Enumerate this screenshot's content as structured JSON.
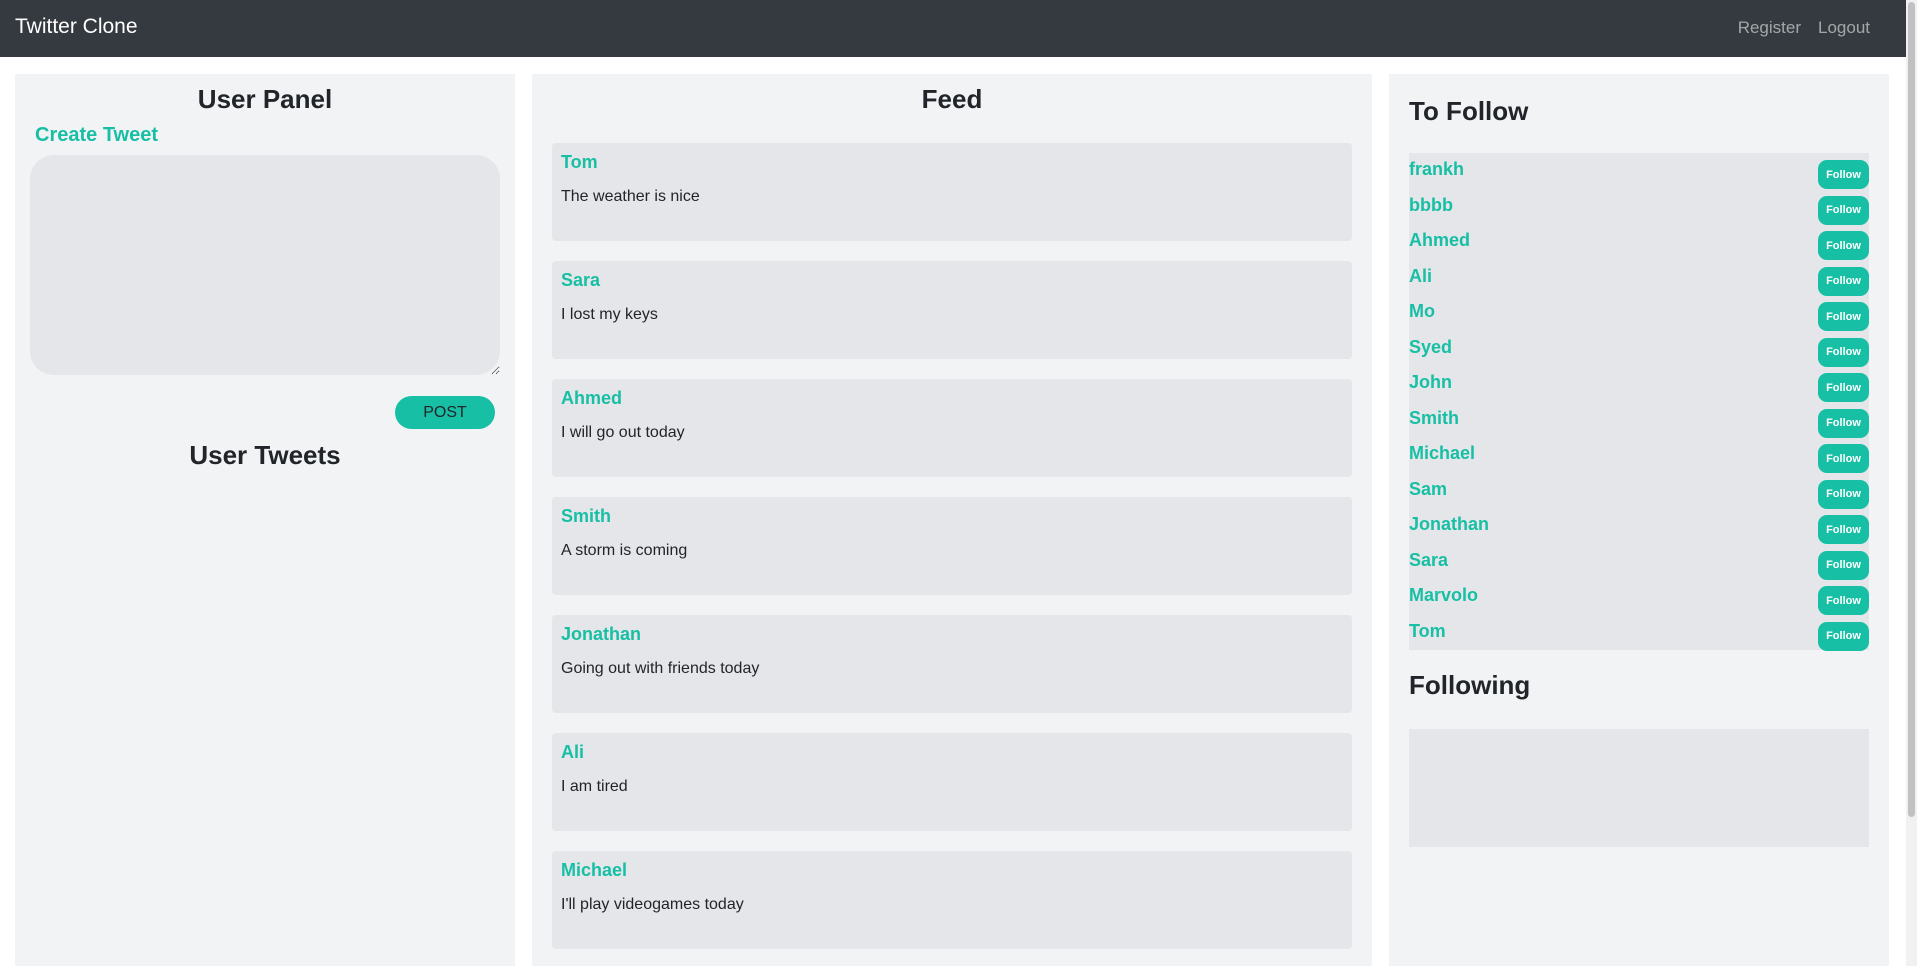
{
  "navbar": {
    "brand": "Twitter Clone",
    "links": [
      "Register",
      "Logout"
    ]
  },
  "user_panel": {
    "title": "User Panel",
    "create_tweet_label": "Create Tweet",
    "tweet_textarea": {
      "value": "",
      "placeholder": ""
    },
    "post_button": "POST",
    "user_tweets_title": "User Tweets"
  },
  "feed": {
    "title": "Feed",
    "tweets": [
      {
        "user": "Tom",
        "text": "The weather is nice"
      },
      {
        "user": "Sara",
        "text": "I lost my keys"
      },
      {
        "user": "Ahmed",
        "text": "I will go out today"
      },
      {
        "user": "Smith",
        "text": "A storm is coming"
      },
      {
        "user": "Jonathan",
        "text": "Going out with friends today"
      },
      {
        "user": "Ali",
        "text": "I am tired"
      },
      {
        "user": "Michael",
        "text": "I'll play videogames today"
      }
    ]
  },
  "to_follow": {
    "title": "To Follow",
    "button_label": "Follow",
    "users": [
      "frankh",
      "bbbb",
      "Ahmed",
      "Ali",
      "Mo",
      "Syed",
      "John",
      "Smith",
      "Michael",
      "Sam",
      "Jonathan",
      "Sara",
      "Marvolo",
      "Tom"
    ]
  },
  "following": {
    "title": "Following",
    "users": []
  },
  "colors": {
    "accent": "#17bfa5",
    "navbar": "#343a40",
    "panel": "#f2f3f5",
    "card": "#e5e6e9"
  }
}
